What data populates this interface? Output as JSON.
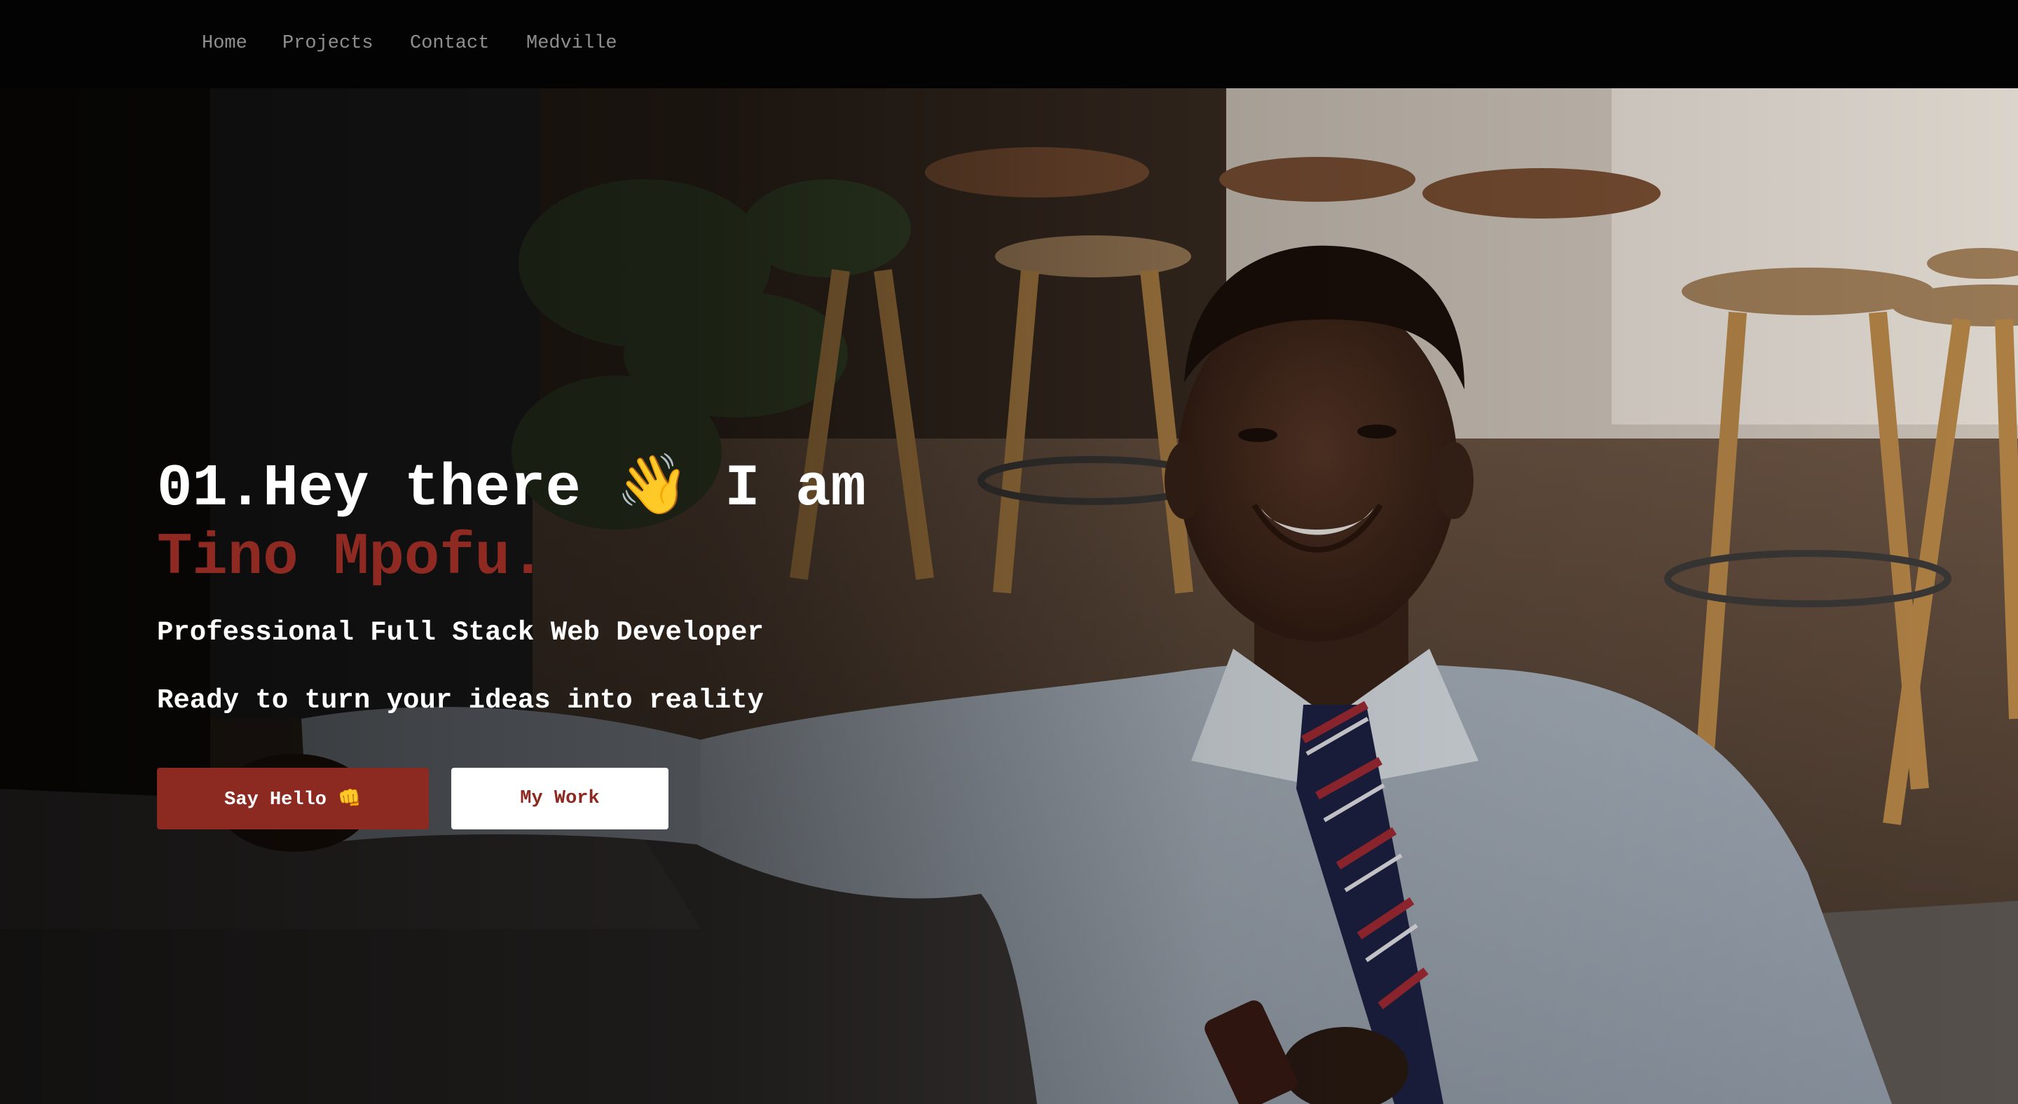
{
  "nav": {
    "items": [
      {
        "label": "Home"
      },
      {
        "label": "Projects"
      },
      {
        "label": "Contact"
      },
      {
        "label": "Medville"
      }
    ]
  },
  "hero": {
    "headline": "01.Hey there 👋 I am",
    "name": "Tino Mpofu.",
    "subtitle": "Professional Full Stack Web Developer",
    "tagline": "Ready to turn your ideas into reality",
    "primary_button": "Say Hello 👊",
    "secondary_button": "My Work"
  },
  "colors": {
    "accent": "#8c2a22",
    "nav_background": "#030303",
    "nav_text": "#8f8f8f",
    "text_primary": "#ffffff"
  }
}
